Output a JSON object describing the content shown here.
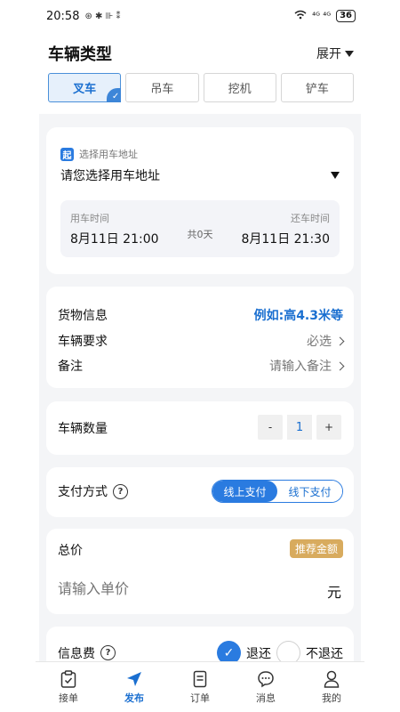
{
  "status_bar": {
    "time": "20:58",
    "left_icons": "⊛ ✱ ⊪ ⁑",
    "signal": "⁴ᴳ ⁴ᴳ",
    "battery": "36"
  },
  "vehicle_type": {
    "title": "车辆类型",
    "expand_label": "展开",
    "tabs": [
      {
        "label": "叉车",
        "active": true
      },
      {
        "label": "吊车",
        "active": false
      },
      {
        "label": "挖机",
        "active": false
      },
      {
        "label": "铲车",
        "active": false
      }
    ]
  },
  "address": {
    "badge": "起",
    "hint": "选择用车地址",
    "placeholder": "请您选择用车地址",
    "start_label": "用车时间",
    "start_value": "8月11日 21:00",
    "duration": "共0天",
    "end_label": "还车时间",
    "end_value": "8月11日 21:30"
  },
  "info": {
    "cargo_label": "货物信息",
    "cargo_value": "例如:高4.3米等",
    "requirement_label": "车辆要求",
    "requirement_value": "必选",
    "remark_label": "备注",
    "remark_value": "请输入备注"
  },
  "quantity": {
    "label": "车辆数量",
    "minus": "-",
    "value": "1",
    "plus": "+"
  },
  "payment": {
    "label": "支付方式",
    "help": "?",
    "online": "线上支付",
    "offline": "线下支付",
    "selected": "online"
  },
  "price": {
    "label": "总价",
    "recommend": "推荐金额",
    "placeholder": "请输入单价",
    "unit": "元"
  },
  "fee": {
    "label": "信息费",
    "help": "?",
    "refund": "退还",
    "no_refund": "不退还",
    "selected": "refund"
  },
  "nav": [
    {
      "label": "接单",
      "icon": "clipboard-check-icon",
      "active": false
    },
    {
      "label": "发布",
      "icon": "send-icon",
      "active": true
    },
    {
      "label": "订单",
      "icon": "document-icon",
      "active": false
    },
    {
      "label": "消息",
      "icon": "chat-icon",
      "active": false
    },
    {
      "label": "我的",
      "icon": "user-icon",
      "active": false
    }
  ],
  "colors": {
    "accent": "#2a7be0",
    "recommend_badge": "#d8ab5e",
    "background": "#f4f5f7"
  }
}
